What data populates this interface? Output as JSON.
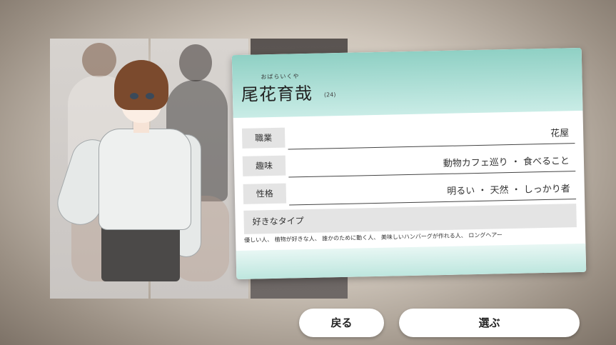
{
  "profile": {
    "furigana": "おばらいくや",
    "name": "尾花育哉",
    "age": "(24)",
    "rows": [
      {
        "label": "職業",
        "value": "花屋"
      },
      {
        "label": "趣味",
        "value": "動物カフェ巡り ・ 食べること"
      },
      {
        "label": "性格",
        "value": "明るい ・ 天然 ・ しっかり者"
      }
    ],
    "type_label": "好きなタイプ",
    "type_text": "優しい人、 植物が好きな人、 誰かのために動く人、 美味しいハンバーグが作れる人、 ロングヘアー"
  },
  "buttons": {
    "back": "戻る",
    "select": "選ぶ"
  },
  "colors": {
    "card_header": "#8fd0c4",
    "card_body": "#ffffff",
    "label_bg": "#e4e4e4"
  }
}
